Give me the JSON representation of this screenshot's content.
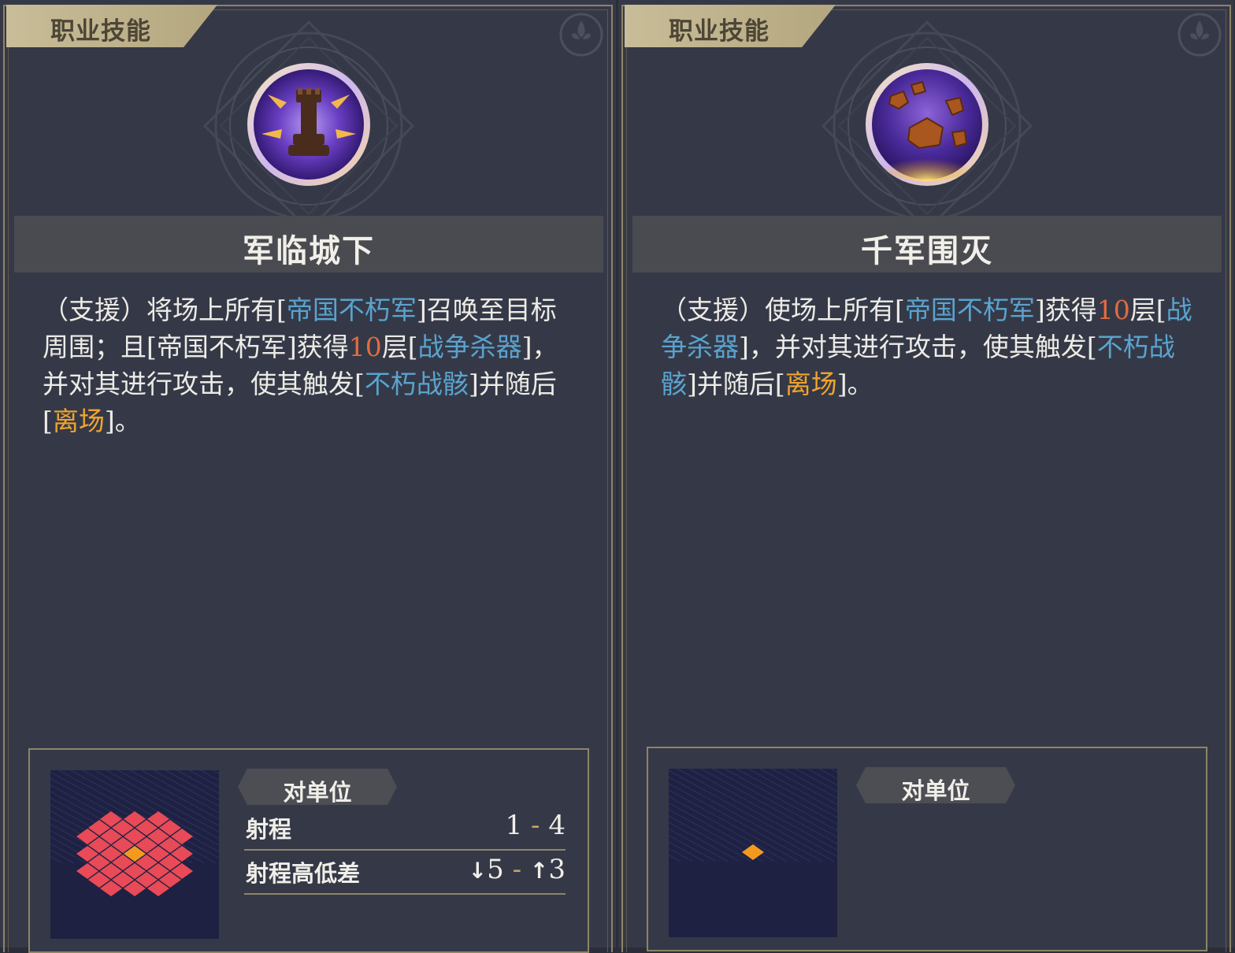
{
  "cards": [
    {
      "tab_label": "职业技能",
      "skill_name": "军临城下",
      "icon": "chess-rook-icon",
      "description": [
        {
          "t": "（支援）将场上所有[",
          "s": "n"
        },
        {
          "t": "帝国不朽军",
          "s": "kw"
        },
        {
          "t": "]召唤至目标周围；且[帝国不朽军]获得",
          "s": "n"
        },
        {
          "t": "10",
          "s": "num"
        },
        {
          "t": "层[",
          "s": "n"
        },
        {
          "t": "战争杀器",
          "s": "kw"
        },
        {
          "t": "]，并对其进行攻击，使其触发[",
          "s": "n"
        },
        {
          "t": "不朽战骸",
          "s": "kw"
        },
        {
          "t": "]并随后[",
          "s": "n"
        },
        {
          "t": "离场",
          "s": "leave"
        },
        {
          "t": "]。",
          "s": "n"
        }
      ],
      "target_badge": "对单位",
      "stats": [
        {
          "label": "射程",
          "min": "1",
          "sep": "-",
          "max": "4"
        },
        {
          "label": "射程高低差",
          "min": "5",
          "min_arrow": "↓",
          "sep": "-",
          "max": "3",
          "max_arrow": "↑"
        }
      ],
      "range_pattern": {
        "type": "diamond-area",
        "area_color": "#e84a57",
        "center_color": "#f39a1e"
      }
    },
    {
      "tab_label": "职业技能",
      "skill_name": "千军围灭",
      "icon": "exploding-rocks-icon",
      "description": [
        {
          "t": "（支援）使场上所有[",
          "s": "n"
        },
        {
          "t": "帝国不朽军",
          "s": "kw"
        },
        {
          "t": "]获得",
          "s": "n"
        },
        {
          "t": "10",
          "s": "num"
        },
        {
          "t": "层[",
          "s": "n"
        },
        {
          "t": "战争杀器",
          "s": "kw"
        },
        {
          "t": "]，并对其进行攻击，使其触发[",
          "s": "n"
        },
        {
          "t": "不朽战骸",
          "s": "kw"
        },
        {
          "t": "]并随后[",
          "s": "n"
        },
        {
          "t": "离场",
          "s": "leave"
        },
        {
          "t": "]。",
          "s": "n"
        }
      ],
      "target_badge": "对单位",
      "stats": [],
      "range_pattern": {
        "type": "single-tile",
        "center_color": "#f39a1e"
      }
    }
  ],
  "colors": {
    "keyword": "#5aa3cf",
    "number": "#e26b43",
    "leave": "#f0a42e",
    "gold_border": "#8e8466"
  }
}
